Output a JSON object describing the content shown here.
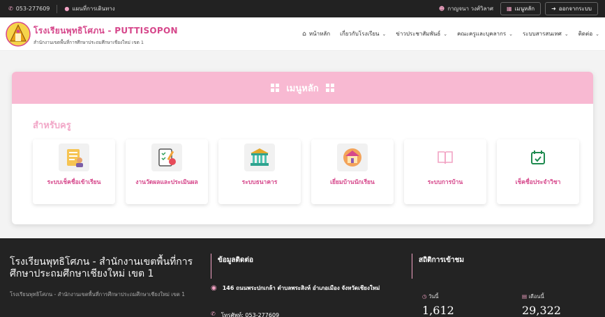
{
  "topbar": {
    "phone": "053-277609",
    "map_link": "แผนที่การเดินทาง",
    "user_name": "กาญจนา วงศ์วิลาศ",
    "menu_button": "เมนูหลัก",
    "logout_button": "ออกจากระบบ"
  },
  "header": {
    "brand_name": "โรงเรียนพุทธิโศภน - PUTTISOPON",
    "brand_sub": "สำนักงานเขตพื้นที่การศึกษาประถมศึกษาเชียงใหม่ เขต 1",
    "nav": [
      {
        "label": "หน้าหลัก",
        "icon": "home-icon",
        "dropdown": false
      },
      {
        "label": "เกี่ยวกับโรงเรียน",
        "dropdown": true
      },
      {
        "label": "ข่าวประชาสัมพันธ์",
        "dropdown": true
      },
      {
        "label": "คณะครูและบุคลากร",
        "dropdown": true
      },
      {
        "label": "ระบบสารสนเทศ",
        "dropdown": true
      },
      {
        "label": "ติดต่อ",
        "dropdown": true
      }
    ]
  },
  "main": {
    "bar_title": "เมนูหลัก",
    "section_title": "สำหรับครู",
    "tiles": [
      {
        "label": "ระบบเช็คชื่อเข้าเรียน",
        "icon": "clipboard-teacher-icon"
      },
      {
        "label": "งานวัดผลและประเมินผล",
        "icon": "assessment-icon"
      },
      {
        "label": "ระบบธนาคาร",
        "icon": "bank-icon"
      },
      {
        "label": "เยี่ยมบ้านนักเรียน",
        "icon": "home-visit-icon"
      },
      {
        "label": "ระบบการบ้าน",
        "icon": "book-icon"
      },
      {
        "label": "เช็คชื่อประจำวิชา",
        "icon": "calendar-check-icon"
      }
    ]
  },
  "footer": {
    "school_name": "โรงเรียนพุทธิโศภน - สำนักงานเขตพื้นที่การศึกษาประถมศึกษาเชียงใหม่ เขต 1",
    "school_desc": "โรงเรียนพุทธิโศภน - สำนักงานเขตพื้นที่การศึกษาประถมศึกษาเชียงใหม่ เขต 1",
    "contact_title": "ข้อมูลติดต่อ",
    "address": "146 ถนนพระปกเกล้า ตำบลพระสิงห์ อำเภอเมือง จังหวัดเชียงใหม่",
    "phone": "โทรศัพท์: 053-277609",
    "stats_title": "สถิติการเข้าชม",
    "today_label": "วันนี้",
    "today_value": "1,612",
    "month_label": "เดือนนี้",
    "month_value": "29,322"
  },
  "colors": {
    "accent": "#d6478b",
    "pink_bar": "#f8b9d2",
    "topbar": "#222222",
    "footer": "#232323"
  }
}
